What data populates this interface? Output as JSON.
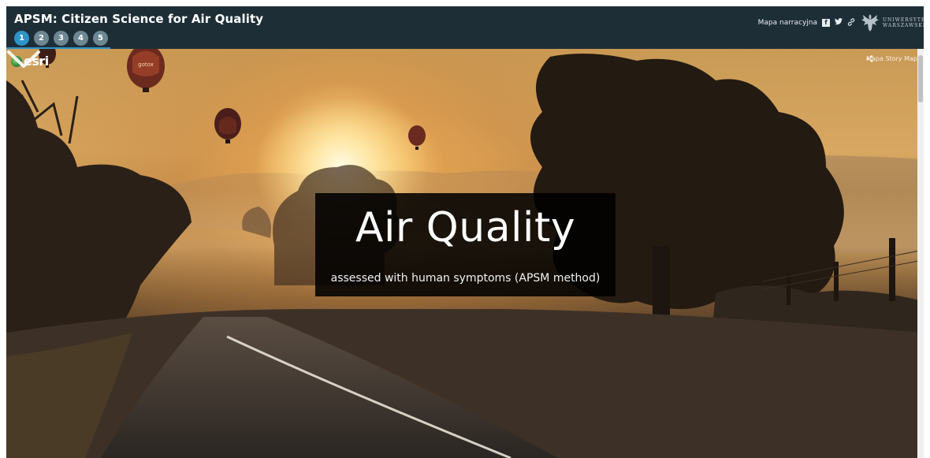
{
  "header": {
    "title": "APSM: Citizen Science for Air Quality",
    "nav_items": [
      "1",
      "2",
      "3",
      "4",
      "5"
    ],
    "active_item": "1",
    "story_link": "Mapa narracyjna",
    "social": {
      "facebook": "f",
      "twitter": "t",
      "link": "🔗"
    },
    "university_logo_text": "UNIWERSYTET WARSZAWSKI"
  },
  "hero": {
    "brand": "esri",
    "share_label": "Mapa Story Map",
    "title": "Air Quality",
    "subtitle": "assessed with human symptoms (APSM method)",
    "balloon_text": "gotox"
  },
  "colors": {
    "header_bg": "#1e2e37",
    "nav_active": "#2d94c8",
    "nav_inactive": "#6d8793",
    "card_bg": "#000000"
  },
  "icons": {
    "scroll": "chevron-down-icon",
    "share": "share-icon",
    "facebook": "facebook-icon",
    "twitter": "twitter-icon",
    "link": "link-icon"
  }
}
